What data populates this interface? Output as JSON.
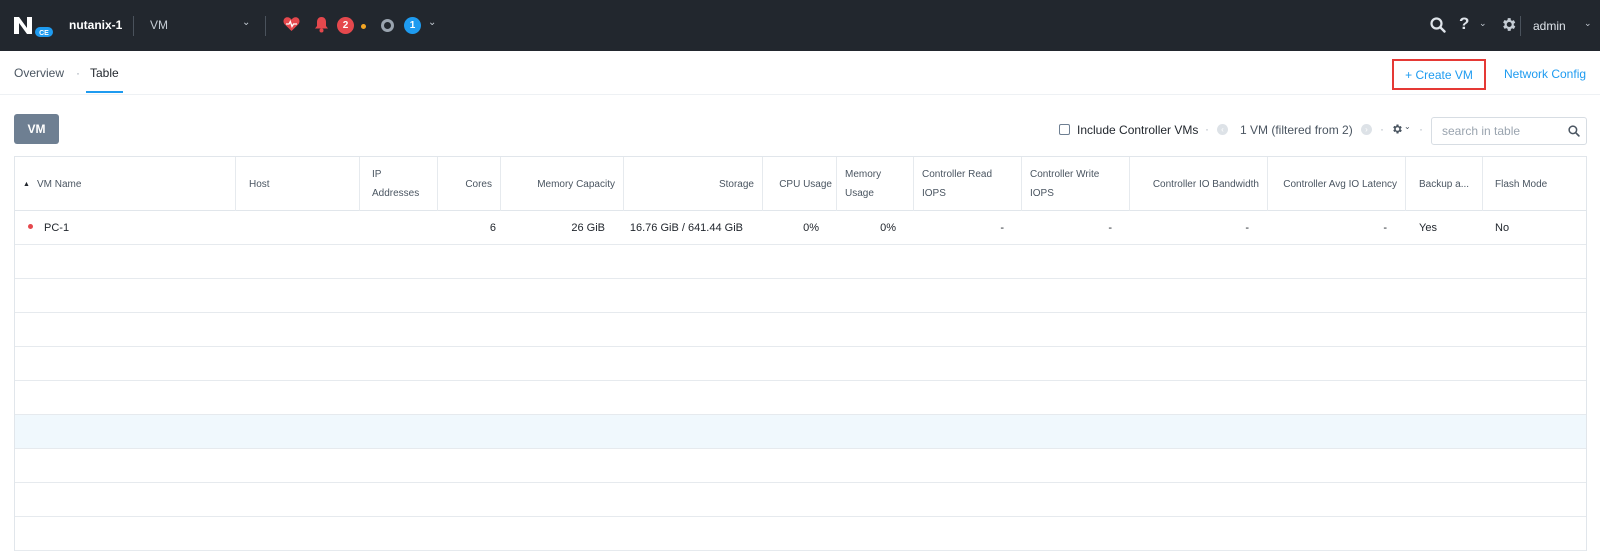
{
  "header": {
    "cluster_name": "nutanix-1",
    "logo_text": "CE",
    "entity_menu": "VM",
    "alerts_count": "2",
    "tasks_count": "1",
    "user": "admin"
  },
  "nav": {
    "tabs": [
      "Overview",
      "Table"
    ],
    "active_tab": "Table",
    "create_vm_label": "+ Create VM",
    "network_config_label": "Network Config"
  },
  "toolbar": {
    "vm_button": "VM",
    "include_controller_label": "Include Controller VMs",
    "include_controller_checked": false,
    "count_label": "1 VM (filtered from 2)",
    "search_placeholder": "search in table"
  },
  "table": {
    "columns": [
      "VM Name",
      "Host",
      "IP Addresses",
      "Cores",
      "Memory Capacity",
      "Storage",
      "CPU Usage",
      "Memory Usage",
      "Controller Read IOPS",
      "Controller Write IOPS",
      "Controller IO Bandwidth",
      "Controller Avg IO Latency",
      "Backup a...",
      "Flash Mode"
    ],
    "rows": [
      {
        "vm_name": "PC-1",
        "host": "",
        "ip_addresses": "",
        "cores": "6",
        "memory_capacity": "26 GiB",
        "storage": "16.76 GiB / 641.44 GiB",
        "cpu_usage": "0%",
        "memory_usage": "0%",
        "controller_read_iops": "-",
        "controller_write_iops": "-",
        "controller_io_bandwidth": "-",
        "controller_avg_io_latency": "-",
        "backup": "Yes",
        "flash_mode": "No"
      }
    ]
  },
  "colors": {
    "topbar_bg": "#22272e",
    "accent": "#1e9bf0",
    "alert_red": "#e5484d",
    "highlight_border": "#e53935"
  }
}
